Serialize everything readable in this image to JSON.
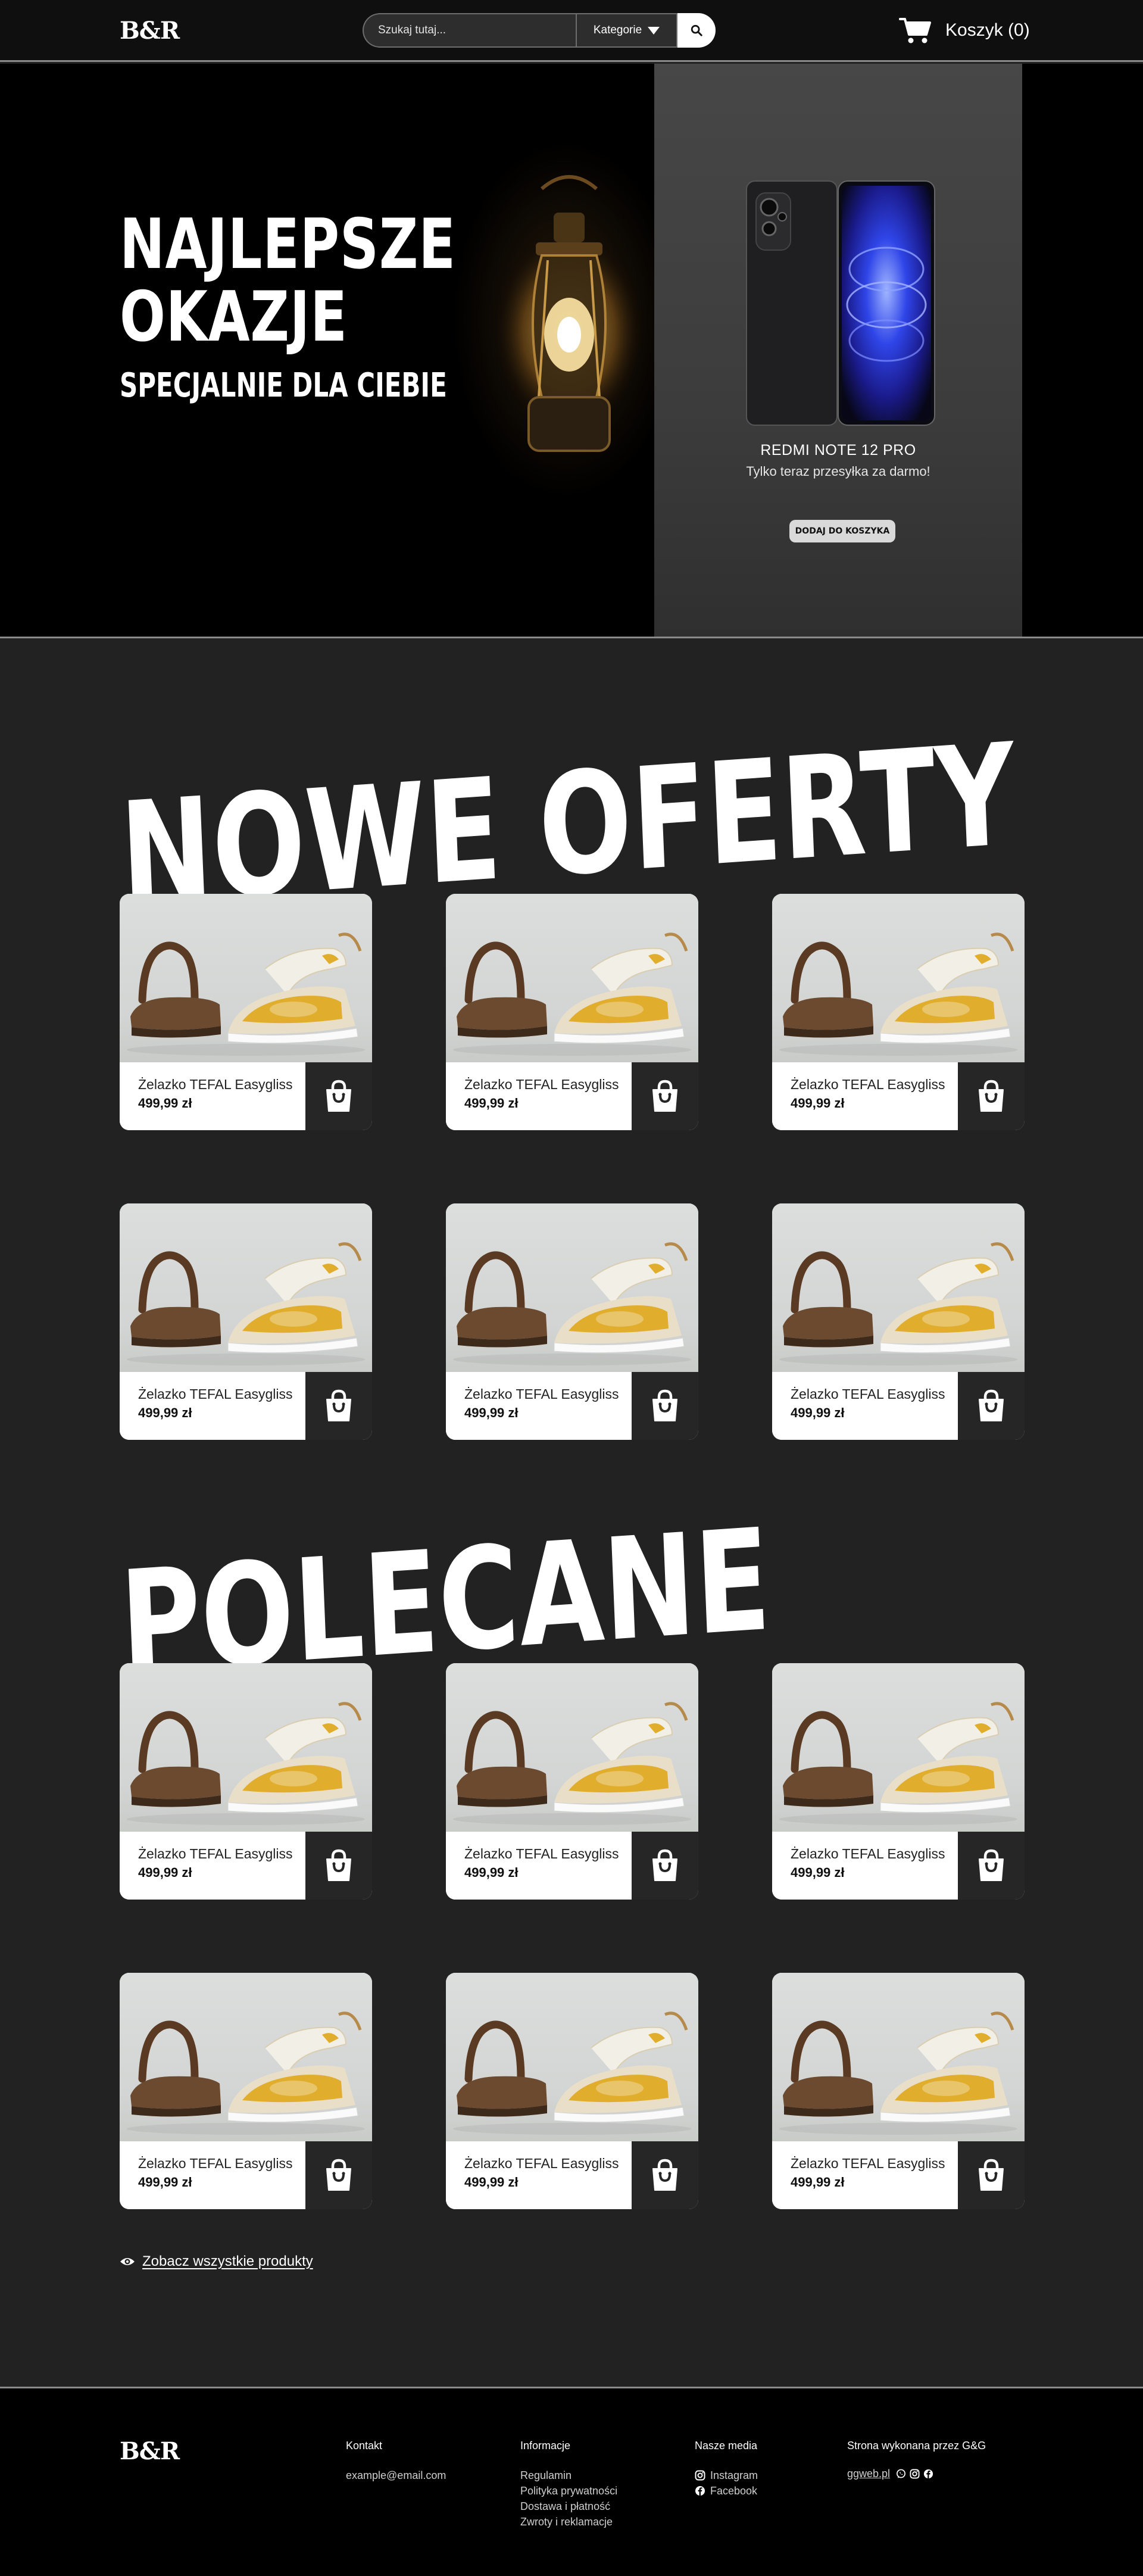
{
  "header": {
    "logo": "B&R",
    "search_placeholder": "Szukaj tutaj...",
    "categories_label": "Kategorie",
    "cart_label": "Koszyk (0)",
    "icons": [
      "search-icon",
      "chevron-down-icon",
      "cart-icon"
    ]
  },
  "hero": {
    "title_line1": "NAJLEPSZE",
    "title_line2": "OKAZJE",
    "subtitle": "SPECJALNIE DLA CIEBIE",
    "promo": {
      "product_name": "REDMI NOTE 12 PRO",
      "tagline": "Tylko teraz przesyłka za darmo!",
      "button_label": "DODAJ DO KOSZYKA"
    }
  },
  "sections": {
    "new_offers_title": "NOWE OFERTY",
    "recommended_title": "POLECANE"
  },
  "new_offers": [
    {
      "name": "Żelazko TEFAL Easygliss",
      "price": "499,99 zł"
    },
    {
      "name": "Żelazko TEFAL Easygliss",
      "price": "499,99 zł"
    },
    {
      "name": "Żelazko TEFAL Easygliss",
      "price": "499,99 zł"
    },
    {
      "name": "Żelazko TEFAL Easygliss",
      "price": "499,99 zł"
    },
    {
      "name": "Żelazko TEFAL Easygliss",
      "price": "499,99 zł"
    },
    {
      "name": "Żelazko TEFAL Easygliss",
      "price": "499,99 zł"
    }
  ],
  "recommended": [
    {
      "name": "Żelazko TEFAL Easygliss",
      "price": "499,99 zł"
    },
    {
      "name": "Żelazko TEFAL Easygliss",
      "price": "499,99 zł"
    },
    {
      "name": "Żelazko TEFAL Easygliss",
      "price": "499,99 zł"
    },
    {
      "name": "Żelazko TEFAL Easygliss",
      "price": "499,99 zł"
    },
    {
      "name": "Żelazko TEFAL Easygliss",
      "price": "499,99 zł"
    },
    {
      "name": "Żelazko TEFAL Easygliss",
      "price": "499,99 zł"
    }
  ],
  "see_all_label": "Zobacz wszystkie produkty",
  "footer": {
    "logo": "B&R",
    "contact": {
      "heading": "Kontakt",
      "email": "example@email.com"
    },
    "info": {
      "heading": "Informacje",
      "links": [
        "Regulamin",
        "Polityka prywatności",
        "Dostawa i płatność",
        "Zwroty i reklamacje"
      ]
    },
    "media": {
      "heading": "Nasze media",
      "instagram": "Instagram",
      "facebook": "Facebook"
    },
    "credit": {
      "heading": "Strona wykonana przez G&G",
      "link": "ggweb.pl"
    }
  },
  "colors": {
    "page_bg": "#222222",
    "header_bg": "#0f0f0f",
    "card_bg": "#ffffff",
    "card_cart_bg": "#262626",
    "promo_bg": "#474747"
  }
}
